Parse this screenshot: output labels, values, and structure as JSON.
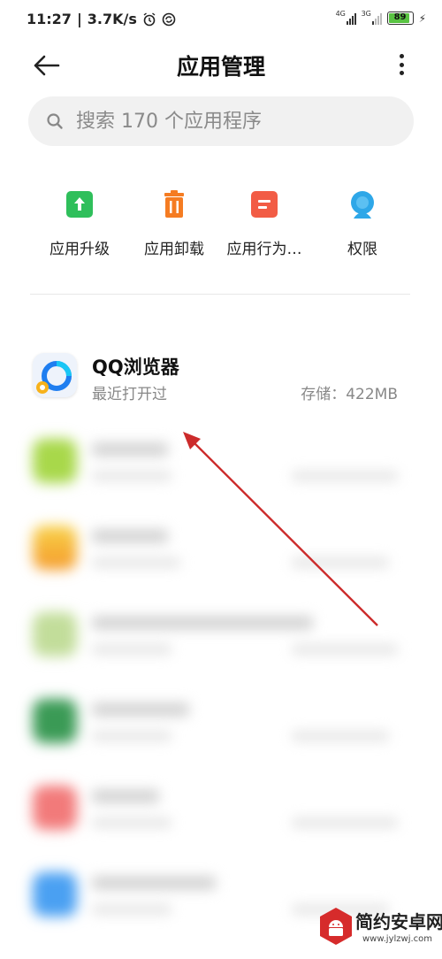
{
  "status_bar": {
    "time": "11:27",
    "speed": "3.7K/s",
    "net1": "4G",
    "net2": "3G",
    "battery": "89"
  },
  "header": {
    "title": "应用管理"
  },
  "search": {
    "placeholder": "搜索 170 个应用程序"
  },
  "quick_actions": [
    {
      "label": "应用升级",
      "icon": "upgrade-icon",
      "color": "#2fbf5b"
    },
    {
      "label": "应用卸载",
      "icon": "trash-icon",
      "color": "#f57c22"
    },
    {
      "label": "应用行为…",
      "icon": "behavior-icon",
      "color": "#f25c45"
    },
    {
      "label": "权限",
      "icon": "permission-icon",
      "color": "#2ea7e8"
    }
  ],
  "apps": [
    {
      "name": "QQ浏览器",
      "sub": "最近打开过",
      "size": "存储：422MB"
    }
  ],
  "colors": {
    "accent_arrow": "#cc2b2b",
    "battery": "#59c342"
  },
  "watermark": {
    "text": "简约安卓网",
    "url": "www.jylzwj.com"
  }
}
